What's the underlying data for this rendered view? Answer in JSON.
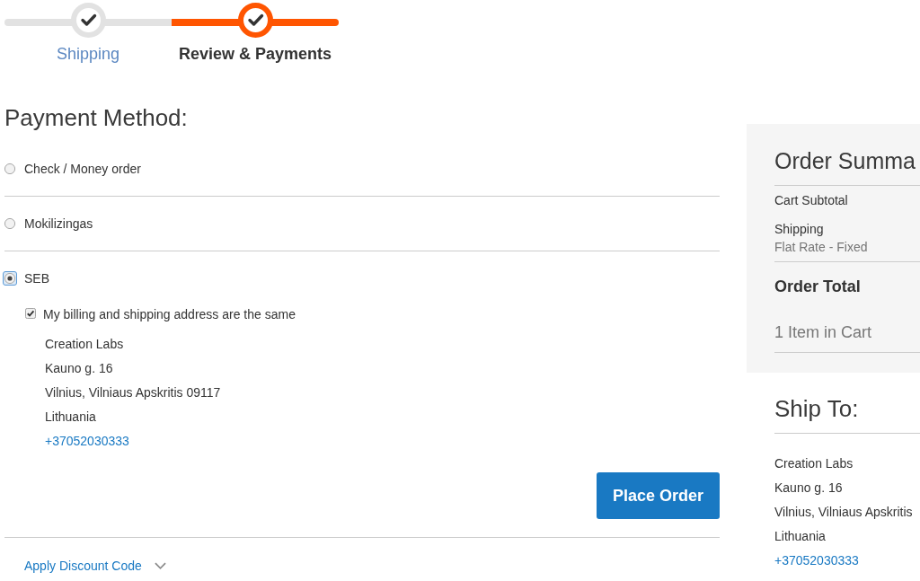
{
  "progress": {
    "steps": [
      {
        "label": "Shipping",
        "selected": false
      },
      {
        "label": "Review & Payments",
        "selected": true
      }
    ]
  },
  "payment": {
    "title": "Payment Method:",
    "methods": [
      {
        "label": "Check / Money order",
        "selected": false
      },
      {
        "label": "Mokilizingas",
        "selected": false
      },
      {
        "label": "SEB",
        "selected": true,
        "details": {
          "same_address": {
            "label": "My billing and shipping address are the same",
            "checked": true
          },
          "address": [
            "Creation Labs",
            "Kauno g. 16",
            "Vilnius, Vilniaus Apskritis 09117",
            "Lithuania"
          ],
          "phone": "+37052030333",
          "button": "Place Order"
        }
      }
    ],
    "discount": {
      "label": "Apply Discount Code",
      "expanded": false
    }
  },
  "order_summary": {
    "title": "Order Summa",
    "rows": [
      {
        "kind": "line",
        "label": "Cart Subtotal"
      },
      {
        "kind": "line",
        "label": "Shipping",
        "note": "Flat Rate - Fixed"
      },
      {
        "kind": "total",
        "label": "Order Total"
      }
    ],
    "items_in_cart": "1 Item in Cart"
  },
  "ship_to": {
    "title": "Ship To:",
    "address": [
      "Creation Labs",
      "Kauno g. 16",
      "Vilnius, Vilniaus Apskritis",
      "Lithuania"
    ],
    "phone": "+37052030333"
  }
}
